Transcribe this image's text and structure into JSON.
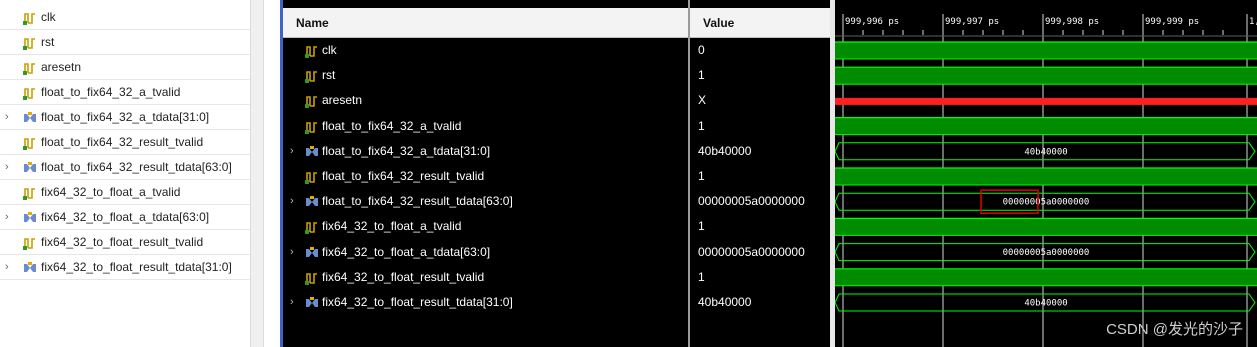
{
  "objects_panel": {
    "items": [
      {
        "label": "clk",
        "kind": "bit",
        "expandable": false
      },
      {
        "label": "rst",
        "kind": "bit",
        "expandable": false
      },
      {
        "label": "aresetn",
        "kind": "bit",
        "expandable": false
      },
      {
        "label": "float_to_fix64_32_a_tvalid",
        "kind": "bit",
        "expandable": false
      },
      {
        "label": "float_to_fix64_32_a_tdata[31:0]",
        "kind": "bus",
        "expandable": true
      },
      {
        "label": "float_to_fix64_32_result_tvalid",
        "kind": "bit",
        "expandable": false
      },
      {
        "label": "float_to_fix64_32_result_tdata[63:0]",
        "kind": "bus",
        "expandable": true
      },
      {
        "label": "fix64_32_to_float_a_tvalid",
        "kind": "bit",
        "expandable": false
      },
      {
        "label": "fix64_32_to_float_a_tdata[63:0]",
        "kind": "bus",
        "expandable": true
      },
      {
        "label": "fix64_32_to_float_result_tvalid",
        "kind": "bit",
        "expandable": false
      },
      {
        "label": "fix64_32_to_float_result_tdata[31:0]",
        "kind": "bus",
        "expandable": true
      }
    ]
  },
  "wave_window": {
    "name_header": "Name",
    "value_header": "Value",
    "time_labels": [
      "999,996 ps",
      "999,997 ps",
      "999,998 ps",
      "999,999 ps",
      "1,"
    ],
    "signals": [
      {
        "name": "clk",
        "value": "0",
        "kind": "bit",
        "expandable": false,
        "wave": "low"
      },
      {
        "name": "rst",
        "value": "1",
        "kind": "bit",
        "expandable": false,
        "wave": "high"
      },
      {
        "name": "aresetn",
        "value": "X",
        "kind": "bit",
        "expandable": false,
        "wave": "x"
      },
      {
        "name": "float_to_fix64_32_a_tvalid",
        "value": "1",
        "kind": "bit",
        "expandable": false,
        "wave": "high"
      },
      {
        "name": "float_to_fix64_32_a_tdata[31:0]",
        "value": "40b40000",
        "kind": "bus",
        "expandable": true,
        "wave": "bus",
        "bus_text": "40b40000"
      },
      {
        "name": "float_to_fix64_32_result_tvalid",
        "value": "1",
        "kind": "bit",
        "expandable": false,
        "wave": "high"
      },
      {
        "name": "float_to_fix64_32_result_tdata[63:0]",
        "value": "00000005a0000000",
        "kind": "bus",
        "expandable": true,
        "wave": "bus",
        "bus_text": "00000005a0000000",
        "highlighted": true
      },
      {
        "name": "fix64_32_to_float_a_tvalid",
        "value": "1",
        "kind": "bit",
        "expandable": false,
        "wave": "high"
      },
      {
        "name": "fix64_32_to_float_a_tdata[63:0]",
        "value": "00000005a0000000",
        "kind": "bus",
        "expandable": true,
        "wave": "bus",
        "bus_text": "00000005a0000000"
      },
      {
        "name": "fix64_32_to_float_result_tvalid",
        "value": "1",
        "kind": "bit",
        "expandable": false,
        "wave": "high"
      },
      {
        "name": "fix64_32_to_float_result_tdata[31:0]",
        "value": "40b40000",
        "kind": "bus",
        "expandable": true,
        "wave": "bus",
        "bus_text": "40b40000"
      }
    ]
  },
  "colors": {
    "wave_green": "#00ff00",
    "wave_fill": "#008c00",
    "x_red": "#ff2020",
    "highlight_box": "#e00000",
    "bit_icon": "#c8a000",
    "bus_icon": "#6a8ccf"
  },
  "icons": {
    "bit": "bit-signal-icon",
    "bus": "bus-signal-icon",
    "expand": "chevron-right-icon"
  },
  "watermark": "CSDN @发光的沙子"
}
